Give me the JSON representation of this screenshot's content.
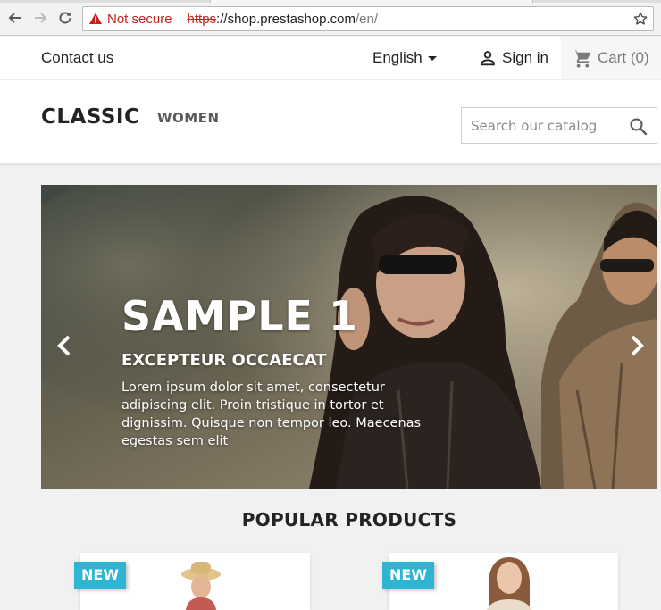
{
  "browser": {
    "security_label": "Not secure",
    "url_scheme": "https",
    "url_host": "://shop.prestashop.com",
    "url_path": "/en/"
  },
  "topnav": {
    "contact_label": "Contact us",
    "language_label": "English",
    "signin_label": "Sign in",
    "cart_label": "Cart (0)"
  },
  "header": {
    "logo_text": "CLASSIC",
    "menu": [
      {
        "label": "WOMEN"
      }
    ],
    "search_placeholder": "Search our catalog"
  },
  "carousel": {
    "title": "SAMPLE 1",
    "subtitle": "EXCEPTEUR OCCAECAT",
    "text": "Lorem ipsum dolor sit amet, consectetur adipiscing elit. Proin tristique in tortor et dignissim. Quisque non tempor leo. Maecenas egestas sem elit"
  },
  "products": {
    "section_title": "POPULAR PRODUCTS",
    "items": [
      {
        "badge": "NEW"
      },
      {
        "badge": "NEW"
      }
    ]
  },
  "colors": {
    "accent": "#2fb5d2",
    "warning": "#c5221f",
    "text": "#232323"
  }
}
